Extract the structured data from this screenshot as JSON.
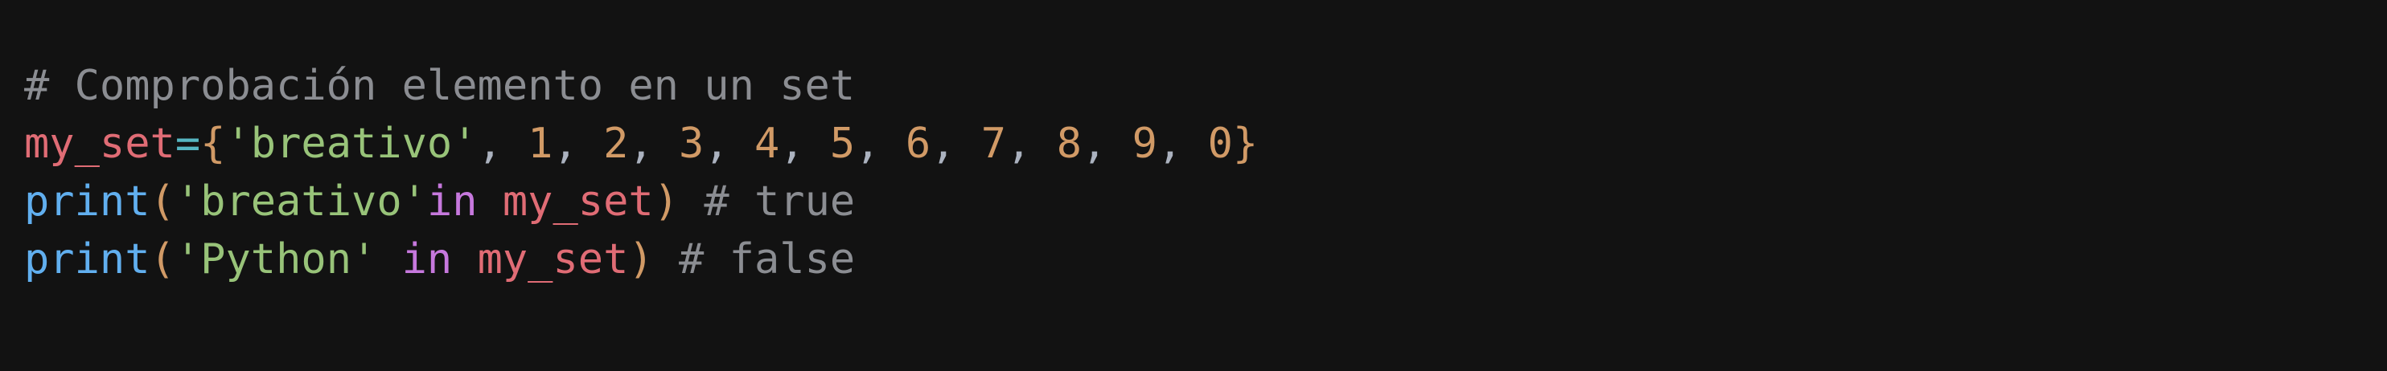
{
  "colors": {
    "background": "#121212",
    "comment": "#8b8d92",
    "variable": "#e06c75",
    "operator": "#56b6c2",
    "brace": "#d19a66",
    "string": "#98c379",
    "number": "#d19a66",
    "punctuation": "#abb2bf",
    "function": "#61afef",
    "keyword": "#c678dd"
  },
  "code": {
    "line1": {
      "comment": "# Comprobación elemento en un set"
    },
    "line2": {
      "var": "my_set",
      "op": "=",
      "open_brace": "{",
      "str": "'breativo'",
      "sep": ", ",
      "nums": [
        "1",
        "2",
        "3",
        "4",
        "5",
        "6",
        "7",
        "8",
        "9",
        "0"
      ],
      "close_brace": "}"
    },
    "line3": {
      "fn": "print",
      "open_paren": "(",
      "str": "'breativo'",
      "kw": "in",
      "var": "my_set",
      "close_paren": ")",
      "comment": "# true"
    },
    "line4": {
      "fn": "print",
      "open_paren": "(",
      "str": "'Python'",
      "kw": "in",
      "var": "my_set",
      "close_paren": ")",
      "comment": "# false"
    }
  }
}
